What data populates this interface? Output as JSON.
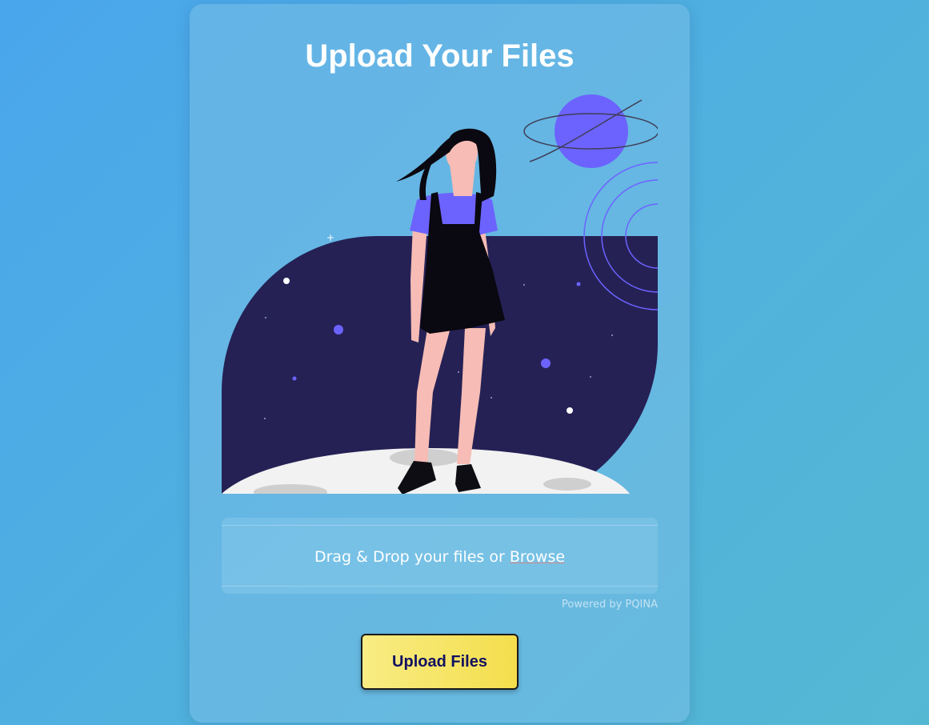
{
  "page": {
    "title": "Upload Your Files"
  },
  "dropzone": {
    "text": "Drag & Drop your files or",
    "browse_label": "Browse"
  },
  "powered_by": "Powered by PQINA",
  "upload_button": {
    "label": "Upload Files"
  },
  "colors": {
    "accent_purple": "#6c63ff",
    "space_navy": "#252155",
    "button_yellow": "#f4de4c",
    "button_text": "#121060"
  },
  "illustration": {
    "icon": "astronaut-girl-on-moon-illustration"
  }
}
